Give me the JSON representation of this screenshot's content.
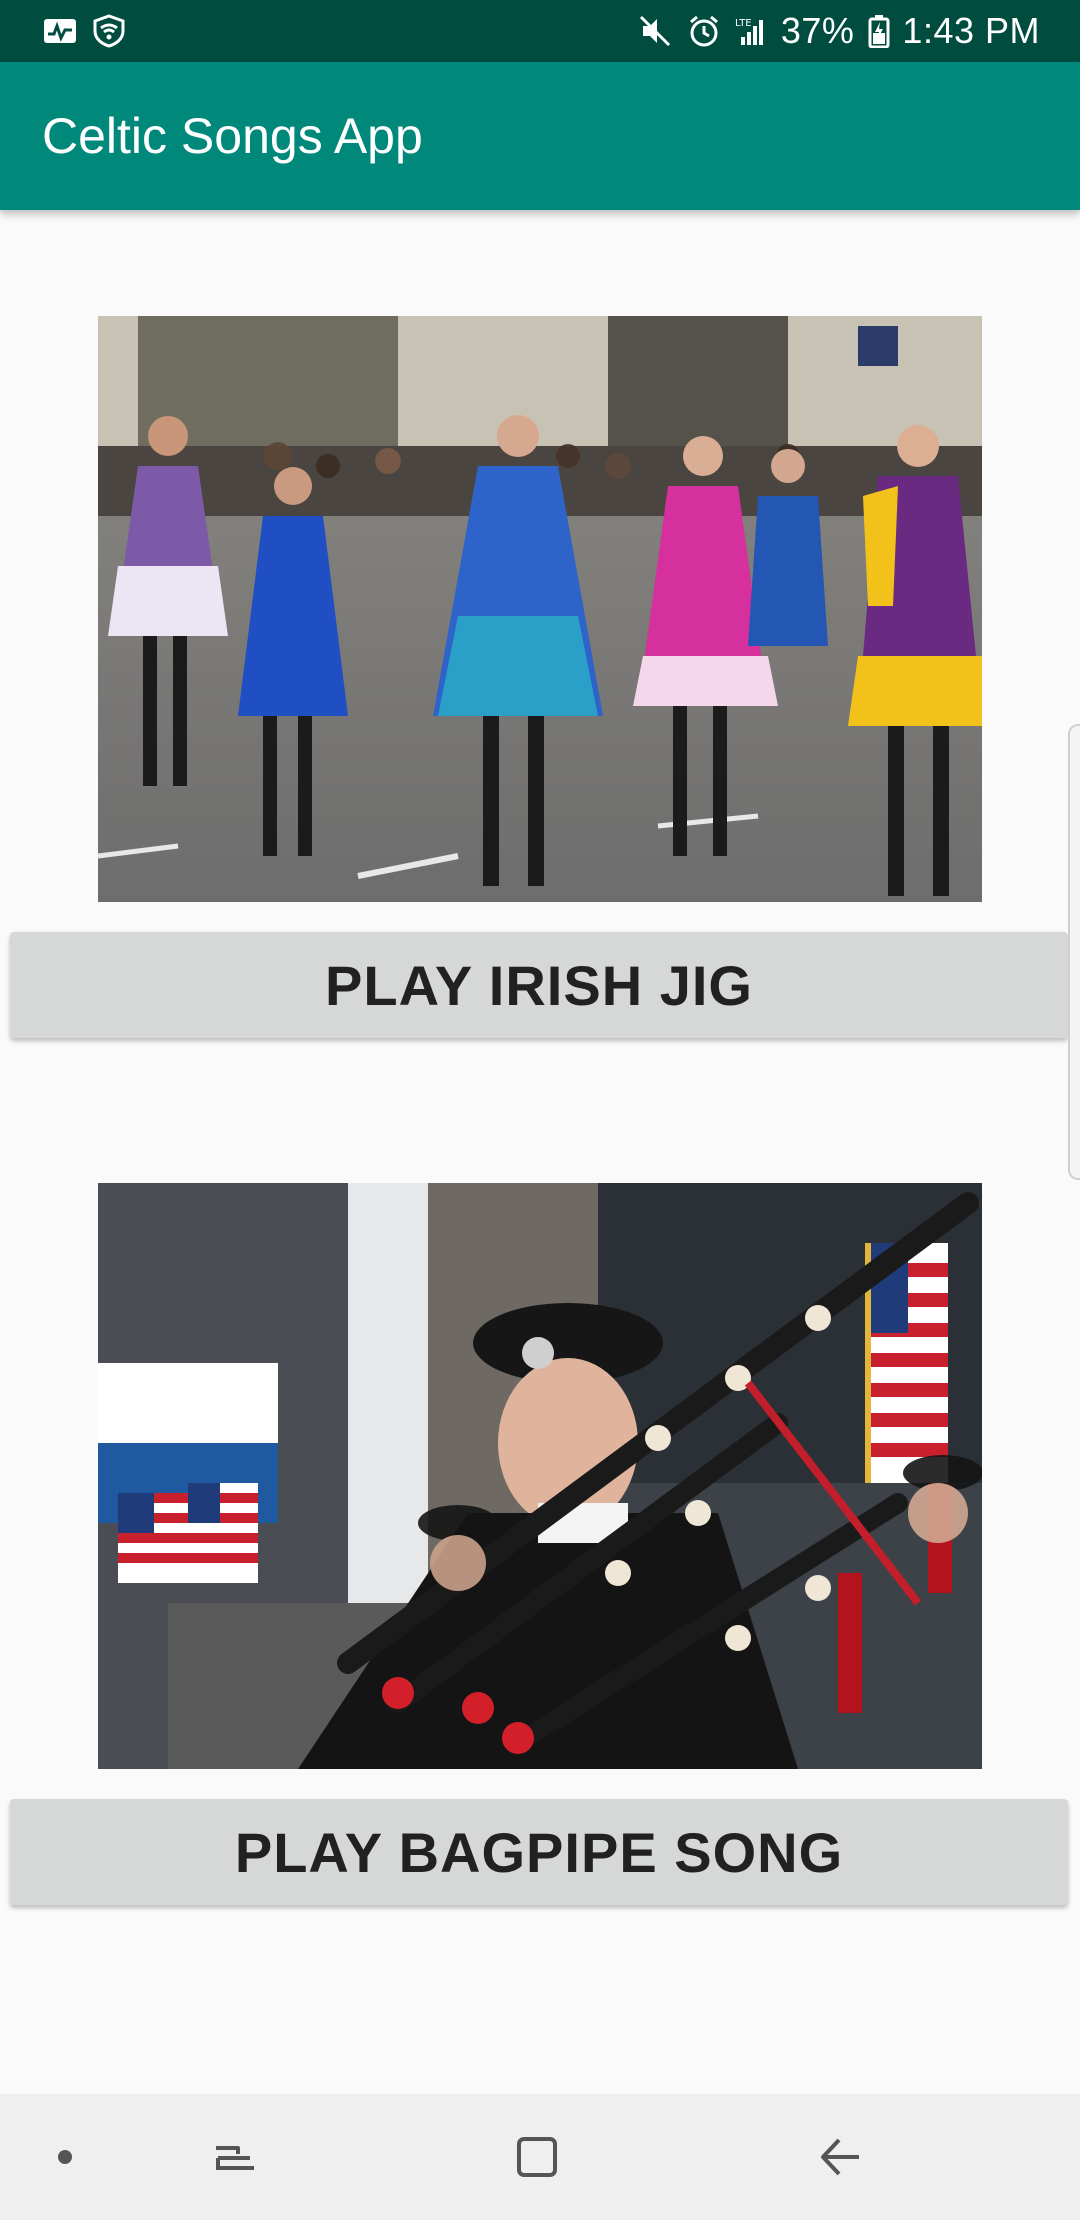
{
  "status_bar": {
    "battery": "37%",
    "time": "1:43 PM",
    "icons": [
      "activity-icon",
      "shield-wifi-icon",
      "mute-icon",
      "alarm-icon",
      "lte-signal-icon",
      "battery-icon"
    ]
  },
  "app_bar": {
    "title": "Celtic Songs App"
  },
  "items": [
    {
      "image": "irish-dancers-photo",
      "button_label": "PLAY IRISH JIG"
    },
    {
      "image": "bagpipers-photo",
      "button_label": "PLAY BAGPIPE SONG"
    }
  ],
  "nav_bar": {
    "icons": [
      "dot-icon",
      "recents-icon",
      "home-icon",
      "back-icon"
    ]
  },
  "colors": {
    "status_bar": "#004d40",
    "app_bar": "#00897b",
    "button": "#d6d7d7",
    "background": "#fafafa"
  }
}
